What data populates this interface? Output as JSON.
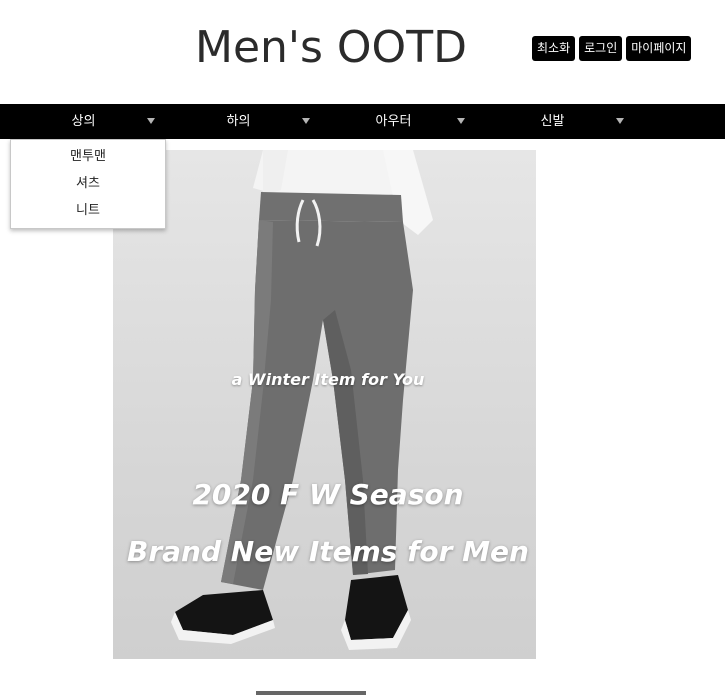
{
  "header": {
    "title": "Men's OOTD",
    "buttons": [
      "최소화",
      "로그인",
      "마이페이지"
    ]
  },
  "nav": {
    "items": [
      {
        "label": "상의",
        "icon": "chevron-down-icon"
      },
      {
        "label": "하의",
        "icon": "chevron-down-icon"
      },
      {
        "label": "아우터",
        "icon": "chevron-down-icon"
      },
      {
        "label": "신발",
        "icon": "chevron-down-icon"
      }
    ],
    "open_menu": {
      "parent": "상의",
      "items": [
        "맨투맨",
        "셔츠",
        "니트"
      ]
    }
  },
  "hero": {
    "tagline": "a Winter Item for You",
    "season": "2020 F  W Season",
    "headline": "Brand New Items for Men"
  },
  "colors": {
    "navbar": "#000000",
    "button_bg": "#000000",
    "button_text": "#ffffff",
    "hero_bg": "#dcdcdc",
    "pants": "#6e6e6e"
  }
}
